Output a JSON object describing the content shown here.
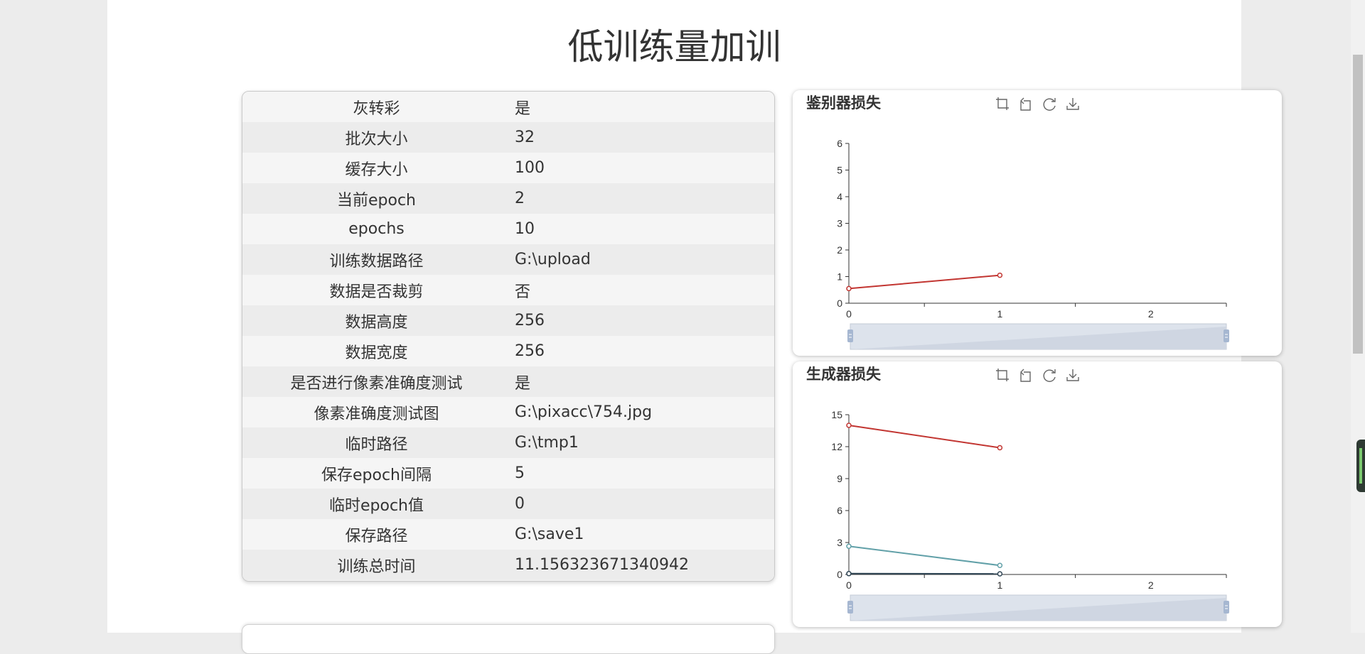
{
  "page": {
    "title": "低训练量加训"
  },
  "info_rows": [
    {
      "label": "灰转彩",
      "value": "是"
    },
    {
      "label": "批次大小",
      "value": "32"
    },
    {
      "label": "缓存大小",
      "value": "100"
    },
    {
      "label": "当前epoch",
      "value": "2"
    },
    {
      "label": "epochs",
      "value": "10"
    },
    {
      "label": "训练数据路径",
      "value": "G:\\upload"
    },
    {
      "label": "数据是否裁剪",
      "value": "否"
    },
    {
      "label": "数据高度",
      "value": "256"
    },
    {
      "label": "数据宽度",
      "value": "256"
    },
    {
      "label": "是否进行像素准确度测试",
      "value": "是"
    },
    {
      "label": "像素准确度测试图",
      "value": "G:\\pixacc\\754.jpg"
    },
    {
      "label": "临时路径",
      "value": "G:\\tmp1"
    },
    {
      "label": "保存epoch间隔",
      "value": "5"
    },
    {
      "label": "临时epoch值",
      "value": "0"
    },
    {
      "label": "保存路径",
      "value": "G:\\save1"
    },
    {
      "label": "训练总时间",
      "value": "11.156323671340942"
    }
  ],
  "toolbox_icons": [
    "area-zoom-icon",
    "zoom-reset-icon",
    "restore-icon",
    "save-image-icon"
  ],
  "chart_data": [
    {
      "id": "discriminator",
      "type": "line",
      "title": "鉴别器损失",
      "x": [
        0,
        1
      ],
      "xlim": [
        0,
        2.5
      ],
      "xticks": [
        0,
        1,
        2
      ],
      "ylim": [
        0,
        6
      ],
      "yticks": [
        0,
        1,
        2,
        3,
        4,
        5,
        6
      ],
      "grid": false,
      "datazoom": true,
      "series": [
        {
          "color": "#c23531",
          "values": [
            0.55,
            1.05
          ]
        }
      ]
    },
    {
      "id": "generator",
      "type": "line",
      "title": "生成器损失",
      "x": [
        0,
        1
      ],
      "xlim": [
        0,
        2.5
      ],
      "xticks": [
        0,
        1,
        2
      ],
      "ylim": [
        0,
        15
      ],
      "yticks": [
        0,
        3,
        6,
        9,
        12,
        15
      ],
      "grid": false,
      "datazoom": true,
      "series": [
        {
          "color": "#c23531",
          "values": [
            14.0,
            11.9
          ]
        },
        {
          "color": "#61a0a8",
          "values": [
            2.65,
            0.85
          ]
        },
        {
          "color": "#2f4554",
          "values": [
            0.08,
            0.06
          ]
        }
      ]
    }
  ]
}
